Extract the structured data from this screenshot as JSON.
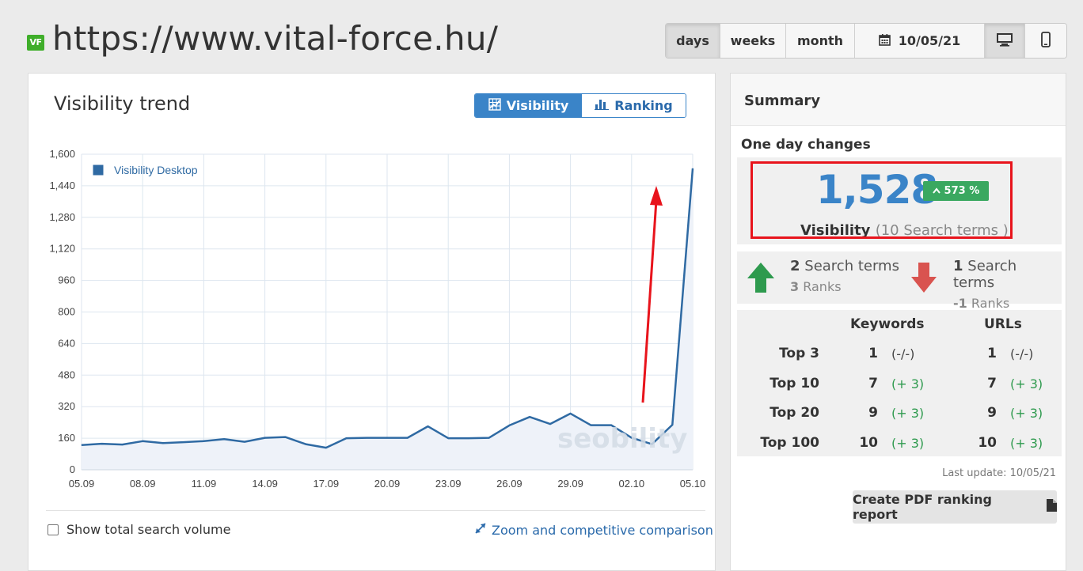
{
  "header": {
    "logo_text": "VF",
    "url": "https://www.vital-force.hu/"
  },
  "toolbar": {
    "days": "days",
    "weeks": "weeks",
    "month": "month",
    "date": "10/05/21",
    "active": "days",
    "device_active": "desktop",
    "icons": [
      "calendar-icon",
      "desktop-icon",
      "mobile-icon"
    ]
  },
  "trend": {
    "title": "Visibility trend",
    "toggle_visibility": "Visibility",
    "toggle_ranking": "Ranking",
    "show_total_label": "Show total search volume",
    "zoom_link": "Zoom and competitive comparison",
    "watermark": "seobility"
  },
  "chart_data": {
    "type": "area",
    "legend": [
      "Visibility Desktop"
    ],
    "legend_position": "top-left",
    "grid": true,
    "y_ticks": [
      "0",
      "160",
      "320",
      "480",
      "640",
      "800",
      "960",
      "1,120",
      "1,280",
      "1,440",
      "1,600"
    ],
    "x_ticks": [
      "05.09",
      "08.09",
      "11.09",
      "14.09",
      "17.09",
      "20.09",
      "23.09",
      "26.09",
      "29.09",
      "02.10",
      "05.10"
    ],
    "ylim": [
      0,
      1600
    ],
    "series": [
      {
        "name": "Visibility Desktop",
        "color": "#2f6aa3",
        "x": [
          "05.09",
          "06.09",
          "07.09",
          "08.09",
          "09.09",
          "10.09",
          "11.09",
          "12.09",
          "13.09",
          "14.09",
          "15.09",
          "16.09",
          "17.09",
          "18.09",
          "19.09",
          "20.09",
          "21.09",
          "22.09",
          "23.09",
          "24.09",
          "25.09",
          "26.09",
          "27.09",
          "28.09",
          "29.09",
          "30.09",
          "01.10",
          "02.10",
          "03.10",
          "04.10",
          "05.10"
        ],
        "values": [
          125,
          132,
          128,
          145,
          135,
          140,
          145,
          155,
          142,
          162,
          166,
          130,
          112,
          160,
          162,
          162,
          162,
          220,
          160,
          160,
          162,
          225,
          268,
          232,
          285,
          226,
          226,
          162,
          130,
          228,
          1528
        ]
      }
    ],
    "annotation": "red arrow pointing up near the last data point"
  },
  "summary": {
    "title": "Summary",
    "one_day_changes": "One day changes",
    "visibility_value": "1,528",
    "visibility_change": "573 %",
    "visibility_label": "Visibility",
    "visibility_sub": "(10 Search terms )",
    "up": {
      "count": "2",
      "label": "Search terms",
      "ranks_value": "3",
      "ranks_label": "Ranks"
    },
    "down": {
      "count": "1",
      "label": "Search terms",
      "ranks_value": "-1",
      "ranks_label": "Ranks"
    },
    "table": {
      "col_keywords": "Keywords",
      "col_urls": "URLs",
      "rows": [
        {
          "label": "Top 3",
          "kw": "1",
          "kw_delta": "(-/-)",
          "url": "1",
          "url_delta": "(-/-)"
        },
        {
          "label": "Top 10",
          "kw": "7",
          "kw_delta": "(+ 3)",
          "url": "7",
          "url_delta": "(+ 3)"
        },
        {
          "label": "Top 20",
          "kw": "9",
          "kw_delta": "(+ 3)",
          "url": "9",
          "url_delta": "(+ 3)"
        },
        {
          "label": "Top 100",
          "kw": "10",
          "kw_delta": "(+ 3)",
          "url": "10",
          "url_delta": "(+ 3)"
        }
      ]
    },
    "last_update": "Last update: 10/05/21",
    "pdf_button": "Create PDF ranking report"
  }
}
